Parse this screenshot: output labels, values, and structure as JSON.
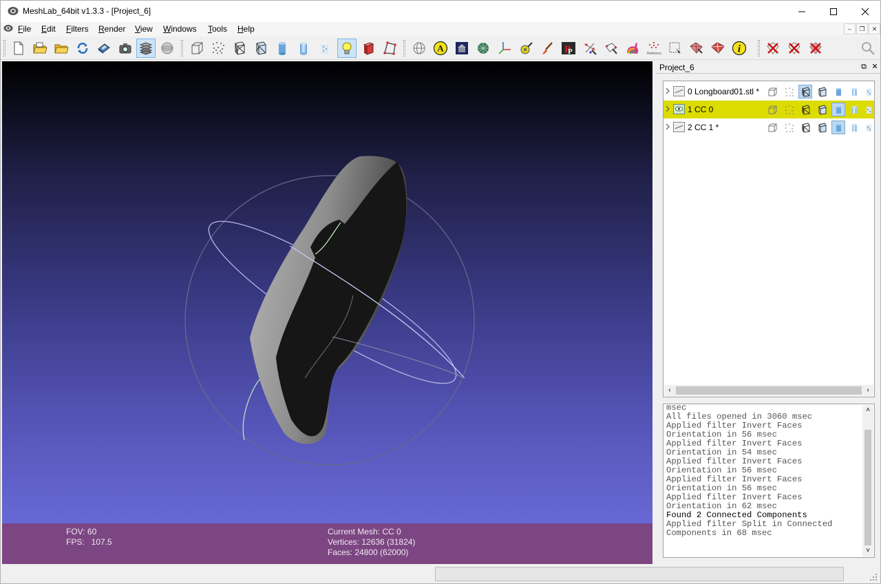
{
  "window": {
    "title": "MeshLab_64bit v1.3.3 - [Project_6]"
  },
  "menu": [
    "File",
    "Edit",
    "Filters",
    "Render",
    "View",
    "Windows",
    "Tools",
    "Help"
  ],
  "toolbar": {
    "buttons": [
      "new-project",
      "open-project",
      "open-mesh",
      "reload",
      "save",
      "snapshot",
      "layers",
      "trackball",
      "bounding-box",
      "points",
      "wireframe",
      "hidden-lines",
      "flat",
      "smooth",
      "texture",
      "light",
      "double-side",
      "back-face",
      "fancy-lighting",
      "annotate",
      "manipulators",
      "painting",
      "quality-mapping",
      "measuring",
      "color-paint",
      "pick-points",
      "align",
      "cutting",
      "reference",
      "select-faces",
      "select-vertices",
      "select-connected",
      "info",
      "delete-faces",
      "delete-vertices",
      "delete-selection",
      "search"
    ],
    "active": [
      "layers",
      "light"
    ]
  },
  "viewport": {
    "background_top": "#000000",
    "background_bottom": "#7070e0",
    "info_left": {
      "fov": "FOV: 60",
      "fps": "FPS:   107.5"
    },
    "info_right": {
      "current_mesh": "Current Mesh: CC 0",
      "vertices": "Vertices: 12636 (31824)",
      "faces": "Faces: 24800 (62000)"
    },
    "info_bar_color": "#7b4682"
  },
  "layer_dock": {
    "title": "Project_6",
    "layers": [
      {
        "label": "0  Longboard01.stl *",
        "current": false,
        "visible": false,
        "wireframe_on": true,
        "flat_on": false
      },
      {
        "label": "1  CC 0",
        "current": true,
        "visible": true,
        "wireframe_on": false,
        "flat_on": true
      },
      {
        "label": "2  CC 1 *",
        "current": false,
        "visible": false,
        "wireframe_on": false,
        "flat_on": true
      }
    ],
    "highlight_color": "#dcdc00"
  },
  "log": {
    "lines": [
      {
        "text": "msec",
        "bold": false
      },
      {
        "text": "All files opened in 3060 msec",
        "bold": false
      },
      {
        "text": "Applied filter Invert Faces",
        "bold": false
      },
      {
        "text": "Orientation in 56 msec",
        "bold": false
      },
      {
        "text": "Applied filter Invert Faces",
        "bold": false
      },
      {
        "text": "Orientation in 54 msec",
        "bold": false
      },
      {
        "text": "Applied filter Invert Faces",
        "bold": false
      },
      {
        "text": "Orientation in 56 msec",
        "bold": false
      },
      {
        "text": "Applied filter Invert Faces",
        "bold": false
      },
      {
        "text": "Orientation in 56 msec",
        "bold": false
      },
      {
        "text": "Applied filter Invert Faces",
        "bold": false
      },
      {
        "text": "Orientation in 62 msec",
        "bold": false
      },
      {
        "text": "Found 2 Connected Components",
        "bold": true
      },
      {
        "text": "Applied filter Split in Connected",
        "bold": false
      },
      {
        "text": "Components in 68 msec",
        "bold": false
      }
    ]
  }
}
